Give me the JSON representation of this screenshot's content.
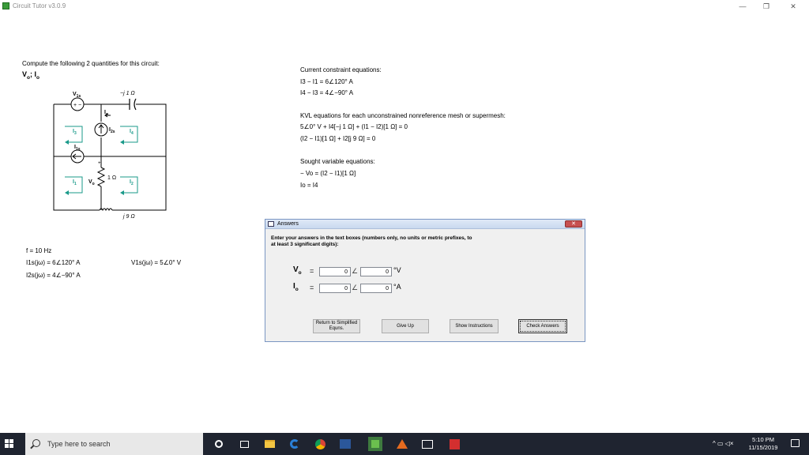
{
  "window": {
    "title": "Circuit Tutor v3.0.9",
    "min": "—",
    "max": "❐",
    "close": "✕"
  },
  "problem": {
    "prompt": "Compute the following 2 quantities for this circuit:",
    "quantities": "V",
    "quantities_sub1": "o",
    "quantities_sep": "; I",
    "quantities_sub2": "o"
  },
  "circuit": {
    "v1s": "V",
    "v1s_sub": "1s",
    "cap": "−j 1 Ω",
    "vsrc_sign": "+ −",
    "io": "I",
    "io_sub": "o",
    "i3": "I",
    "i3_sub": "3",
    "i2s": "I",
    "i2s_sub": "2s",
    "i4": "I",
    "i4_sub": "4",
    "i1s": "I",
    "i1s_sub": "1s",
    "i1": "I",
    "i1_sub": "1",
    "vo": "V",
    "vo_sub": "o",
    "vo_plus": "+",
    "res1": "1 Ω",
    "i2": "I",
    "i2_sub": "2",
    "ind": "j 9 Ω"
  },
  "given": {
    "freq": "f = 10 Hz",
    "i1s": "I1s(jω) = 6∠120° A",
    "i2s": "I2s(jω) = 4∠−90° A",
    "v1s": "V1s(jω) = 5∠0° V"
  },
  "equations": {
    "current_heading": "Current constraint equations:",
    "c1": "I3 − I1 = 6∠120° A",
    "c2": "I4 − I3 = 4∠−90° A",
    "kvl_heading": "KVL equations for each unconstrained nonreference mesh or supermesh:",
    "k1": "5∠0° V + I4[−j 1 Ω] + (I1 − I2)[1 Ω] = 0",
    "k2": "(I2 − I1)[1 Ω] + I2[j 9 Ω] = 0",
    "sought_heading": "Sought variable equations:",
    "s1": "− Vo = (I2 − I1)[1 Ω]",
    "s2": "Io = I4"
  },
  "dialog": {
    "title": "Answers",
    "close": "✕",
    "instructions": "Enter your answers in the text boxes (numbers only, no units or metric prefixes, to at least 3 significant digits):",
    "vo_label": "V",
    "vo_sub": "o",
    "io_label": "I",
    "io_sub": "o",
    "equals": "=",
    "angle": "∠",
    "vo_mag": "0",
    "vo_ang": "0",
    "io_mag": "0",
    "io_ang": "0",
    "vo_unit": "°V",
    "io_unit": "°A",
    "btn_return": "Return to Simplified Equns.",
    "btn_giveup": "Give Up",
    "btn_instructions": "Show Instructions",
    "btn_check": "Check Answers"
  },
  "taskbar": {
    "search_placeholder": "Type here to search",
    "tray": "^ ▭ ◁×",
    "time": "5:10 PM",
    "date": "11/15/2019"
  }
}
